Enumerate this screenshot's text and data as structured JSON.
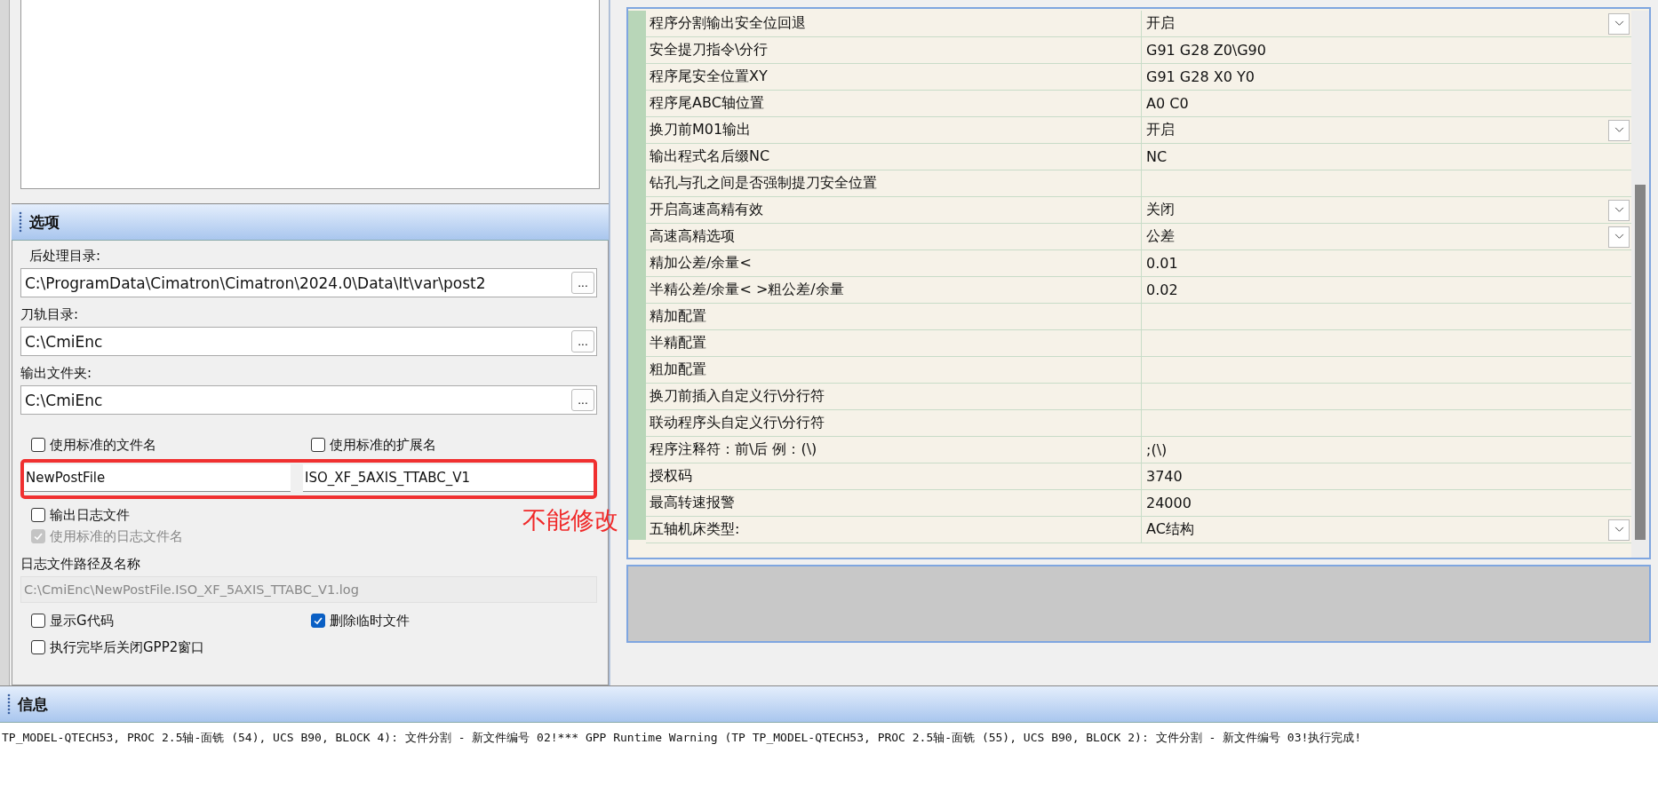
{
  "options": {
    "title": "选项",
    "dirs": [
      {
        "label": "后处理目录:",
        "value": "C:\\ProgramData\\Cimatron\\Cimatron\\2024.0\\Data\\It\\var\\post2",
        "button": "..."
      },
      {
        "label": "刀轨目录:",
        "value": "C:\\CmiEnc",
        "button": "..."
      },
      {
        "label": "输出文件夹:",
        "value": "C:\\CmiEnc",
        "button": "..."
      }
    ],
    "file_name": {
      "checkboxes": [
        {
          "label": "使用标准的文件名",
          "checked": false,
          "disabled": false
        },
        {
          "label": "使用标准的扩展名",
          "checked": false,
          "disabled": false
        }
      ],
      "fields": [
        "NewPostFile",
        "ISO_XF_5AXIS_TTABC_V1"
      ],
      "highlighted": true
    },
    "log": {
      "checkboxes": [
        {
          "label": "输出日志文件",
          "checked": false,
          "disabled": false
        },
        {
          "label": "使用标准的日志文件名",
          "checked": true,
          "disabled": true
        }
      ],
      "path_label": "日志文件路径及名称",
      "path_value": "C:\\CmiEnc\\NewPostFile.ISO_XF_5AXIS_TTABC_V1.log",
      "path_disabled": true
    },
    "extra_checkboxes": [
      {
        "label": "显示G代码",
        "checked": false,
        "disabled": false
      },
      {
        "label": "删除临时文件",
        "checked": true,
        "disabled": false
      },
      {
        "label": "执行完毕后关闭GPP2窗口",
        "checked": false,
        "disabled": false
      }
    ]
  },
  "annotation": {
    "text": "不能修改"
  },
  "params_grid": {
    "rows": [
      {
        "label": "程序分割输出安全位回退",
        "value": "开启",
        "kind": "dropdown"
      },
      {
        "label": "安全提刀指令\\分行",
        "value": "G91 G28 Z0\\G90",
        "kind": "text"
      },
      {
        "label": "程序尾安全位置XY",
        "value": "G91 G28 X0 Y0",
        "kind": "text"
      },
      {
        "label": "程序尾ABC轴位置",
        "value": "A0 C0",
        "kind": "text"
      },
      {
        "label": "换刀前M01输出",
        "value": "开启",
        "kind": "dropdown"
      },
      {
        "label": "输出程式名后缀NC",
        "value": "NC",
        "kind": "text"
      },
      {
        "label": "钻孔与孔之间是否强制提刀安全位置",
        "kind": "text"
      },
      {
        "label": "开启高速高精有效",
        "value": "关闭",
        "kind": "dropdown"
      },
      {
        "label": "高速高精选项",
        "value": "公差",
        "kind": "dropdown"
      },
      {
        "label": "精加公差/余量<",
        "value": "0.01",
        "kind": "text"
      },
      {
        "label": "半精公差/余量< >粗公差/余量",
        "value": "0.02",
        "kind": "text"
      },
      {
        "label": "精加配置",
        "kind": "text"
      },
      {
        "label": "半精配置",
        "kind": "text"
      },
      {
        "label": "粗加配置",
        "kind": "text"
      },
      {
        "label": "换刀前插入自定义行\\分行符",
        "kind": "text"
      },
      {
        "label": "联动程序头自定义行\\分行符",
        "kind": "text"
      },
      {
        "label": "程序注释符：前\\后 例：(\\)",
        "value": ";(\\)",
        "kind": "text"
      },
      {
        "label": "授权码",
        "value": "3740",
        "kind": "text"
      },
      {
        "label": "最高转速报警",
        "value": "24000",
        "kind": "text"
      },
      {
        "label": "五轴机床类型:",
        "value": "AC结构",
        "kind": "dropdown"
      }
    ]
  },
  "info": {
    "title": "信息",
    "message": "TP_MODEL-QTECH53, PROC 2.5轴-面铣 (54), UCS B90, BLOCK 4): 文件分割 - 新文件编号 02!*** GPP Runtime Warning (TP TP_MODEL-QTECH53, PROC 2.5轴-面铣 (55), UCS B90, BLOCK 2): 文件分割 - 新文件编号 03!执行完成!"
  }
}
